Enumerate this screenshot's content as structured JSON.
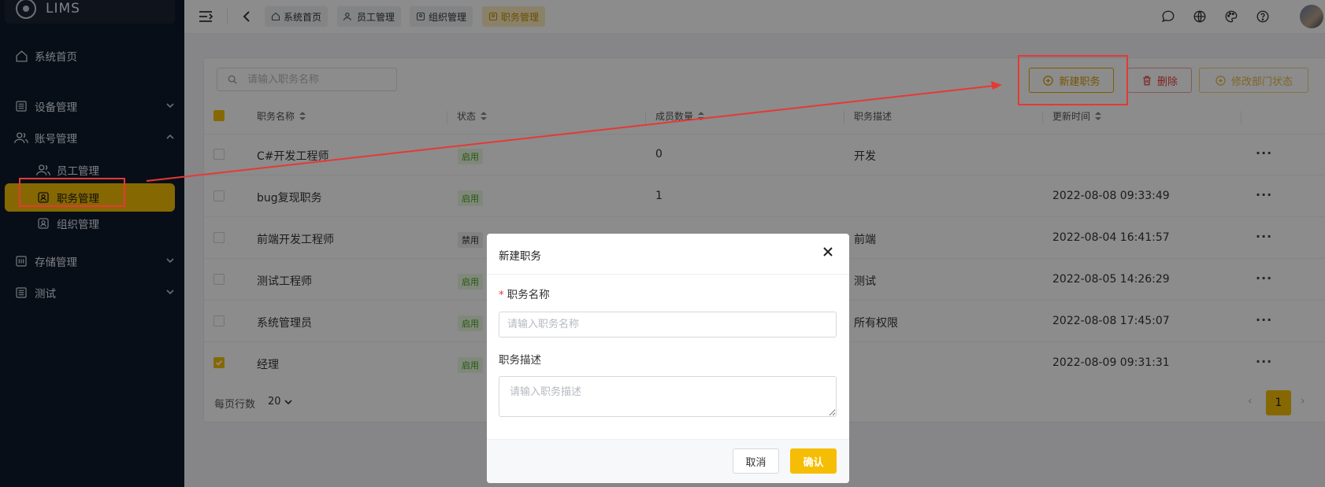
{
  "app": {
    "name": "LIMS"
  },
  "sidebar": {
    "items": [
      {
        "label": "系统首页"
      },
      {
        "label": "设备管理"
      },
      {
        "label": "账号管理"
      },
      {
        "label": "员工管理"
      },
      {
        "label": "职务管理"
      },
      {
        "label": "组织管理"
      },
      {
        "label": "存储管理"
      },
      {
        "label": "测试"
      }
    ]
  },
  "tabs": [
    {
      "label": "系统首页"
    },
    {
      "label": "员工管理"
    },
    {
      "label": "组织管理"
    },
    {
      "label": "职务管理"
    }
  ],
  "toolbar": {
    "search_placeholder": "请输入职务名称",
    "new_label": "新建职务",
    "delete_label": "删除",
    "status_label": "修改部门状态"
  },
  "table": {
    "headers": [
      "职务名称",
      "状态",
      "成员数量",
      "职务描述",
      "更新时间"
    ],
    "rows": [
      {
        "name": "C#开发工程师",
        "status": "启用",
        "members": "0",
        "desc": "开发",
        "updated": "",
        "checked": false
      },
      {
        "name": "bug复现职务",
        "status": "启用",
        "members": "1",
        "desc": "",
        "updated": "2022-08-08 09:33:49",
        "checked": false
      },
      {
        "name": "前端开发工程师",
        "status": "禁用",
        "members": "",
        "desc": "前端",
        "updated": "2022-08-04 16:41:57",
        "checked": false
      },
      {
        "name": "测试工程师",
        "status": "启用",
        "members": "",
        "desc": "测试",
        "updated": "2022-08-05 14:26:29",
        "checked": false
      },
      {
        "name": "系统管理员",
        "status": "启用",
        "members": "",
        "desc": "所有权限",
        "updated": "2022-08-08 17:45:07",
        "checked": false
      },
      {
        "name": "经理",
        "status": "启用",
        "members": "",
        "desc": "",
        "updated": "2022-08-09 09:31:31",
        "checked": true
      }
    ],
    "more_label": "···"
  },
  "pagination": {
    "rows_per_page_label": "每页行数",
    "page_size": "20",
    "current_page": "1"
  },
  "modal": {
    "title": "新建职务",
    "name_label": "职务名称",
    "name_required_mark": "*",
    "name_placeholder": "请输入职务名称",
    "desc_label": "职务描述",
    "desc_placeholder": "请输入职务描述",
    "cancel_label": "取消",
    "confirm_label": "确认"
  },
  "colors": {
    "accent": "#f5be05",
    "sidebar_bg": "#0f1a2c",
    "annotation": "#e53935",
    "enabled": "#45a317"
  }
}
